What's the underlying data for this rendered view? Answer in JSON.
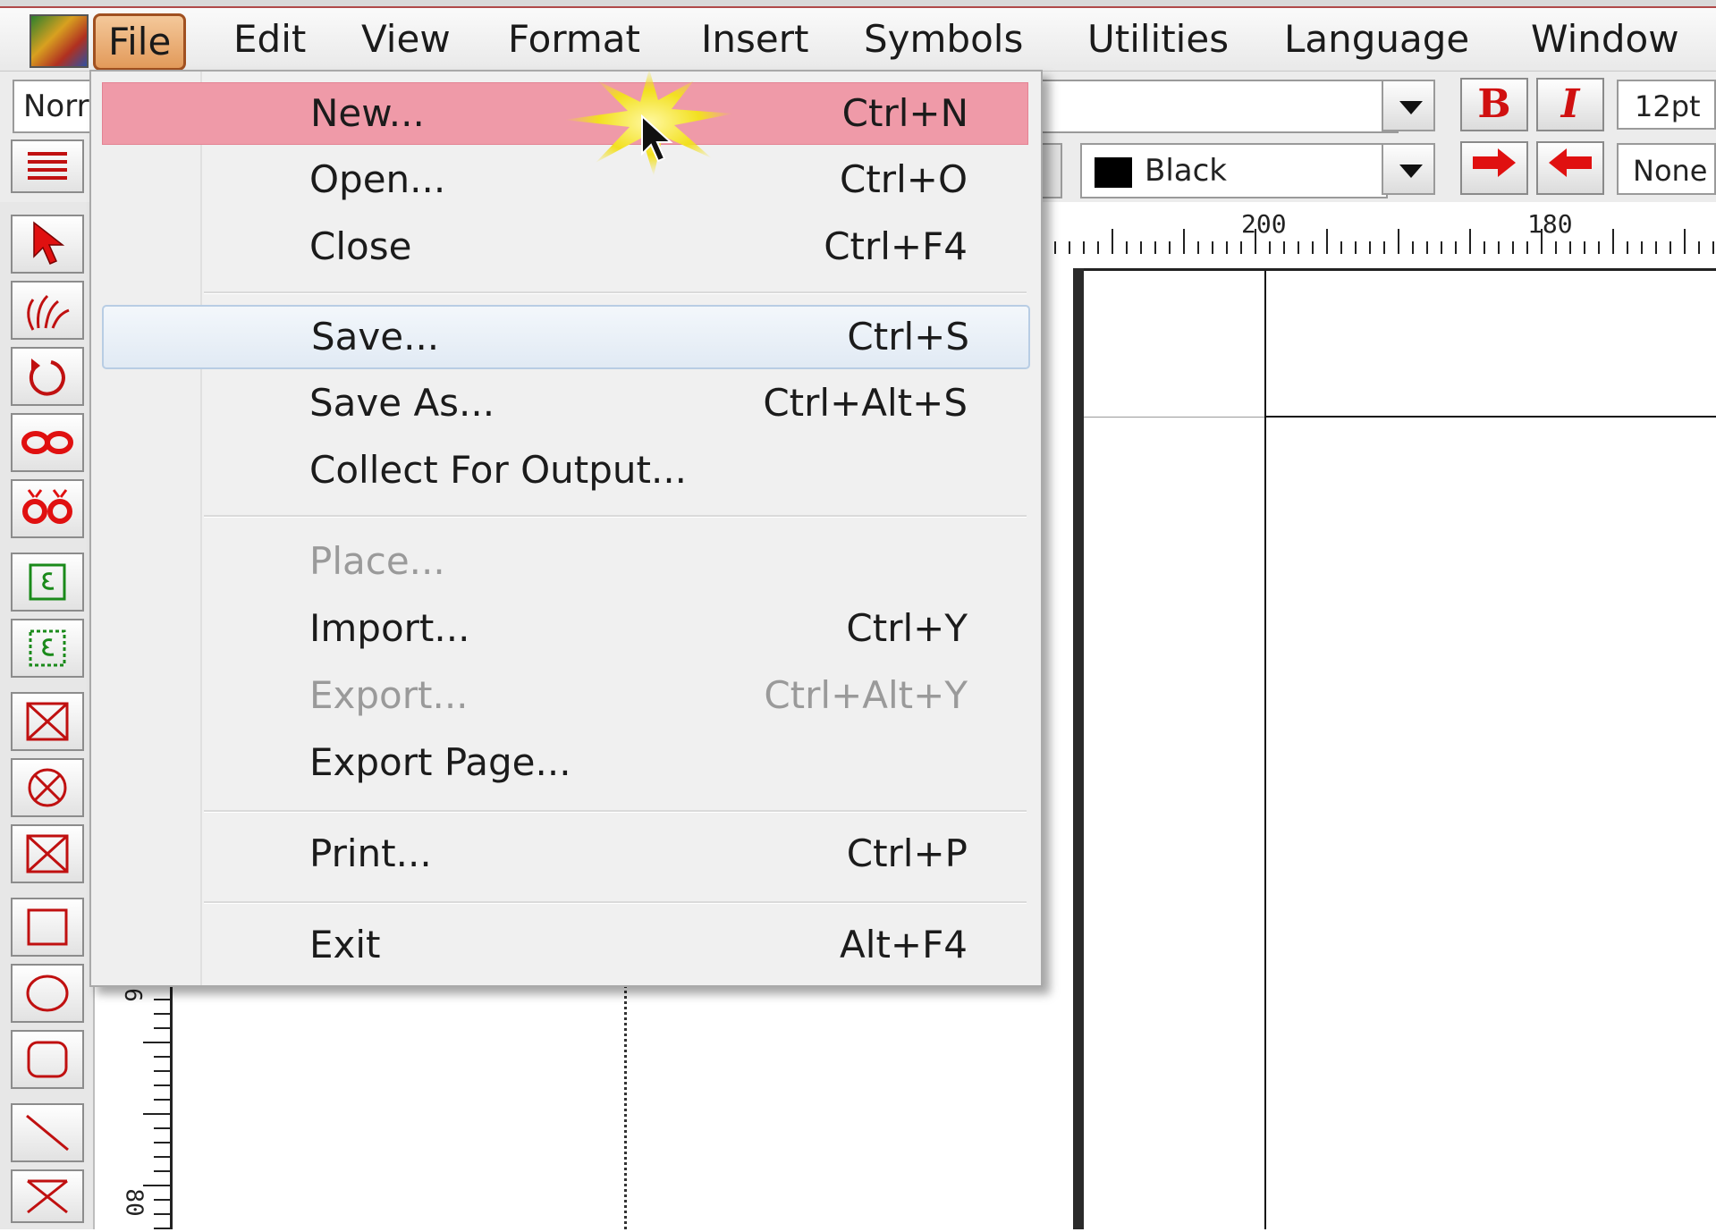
{
  "menubar": {
    "items": [
      {
        "label": "File"
      },
      {
        "label": "Edit"
      },
      {
        "label": "View"
      },
      {
        "label": "Format"
      },
      {
        "label": "Insert"
      },
      {
        "label": "Symbols"
      },
      {
        "label": "Utilities"
      },
      {
        "label": "Language"
      },
      {
        "label": "Window"
      }
    ]
  },
  "toolbar": {
    "style_value": "Norr",
    "bold_label": "B",
    "italic_label": "I",
    "font_size": "12pt",
    "color_value": "Black",
    "line_value": "None"
  },
  "ruler": {
    "h_labels": [
      "200",
      "180"
    ],
    "v_labels": [
      "6",
      "80"
    ]
  },
  "file_menu": {
    "items": [
      {
        "label": "New...",
        "shortcut": "Ctrl+N",
        "state": "hover"
      },
      {
        "label": "Open...",
        "shortcut": "Ctrl+O",
        "state": "enabled"
      },
      {
        "label": "Close",
        "shortcut": "Ctrl+F4",
        "state": "enabled"
      },
      {
        "label": "Save...",
        "shortcut": "Ctrl+S",
        "state": "focused"
      },
      {
        "label": "Save As...",
        "shortcut": "Ctrl+Alt+S",
        "state": "enabled"
      },
      {
        "label": "Collect For Output...",
        "shortcut": "",
        "state": "enabled"
      },
      {
        "label": "Place...",
        "shortcut": "",
        "state": "disabled"
      },
      {
        "label": "Import...",
        "shortcut": "Ctrl+Y",
        "state": "enabled"
      },
      {
        "label": "Export...",
        "shortcut": "Ctrl+Alt+Y",
        "state": "disabled"
      },
      {
        "label": "Export Page...",
        "shortcut": "",
        "state": "enabled"
      },
      {
        "label": "Print...",
        "shortcut": "Ctrl+P",
        "state": "enabled"
      },
      {
        "label": "Exit",
        "shortcut": "Alt+F4",
        "state": "enabled"
      }
    ]
  },
  "colors": {
    "hover_highlight": "#ef9aa8",
    "active_menu": "#e29a5a",
    "tool_red": "#d01010"
  },
  "tools": [
    "pointer-arrow-icon",
    "hand-icon",
    "rotate-icon",
    "link-frames-icon",
    "unlink-frames-icon",
    "text-frame-icon",
    "text-frame-dotted-icon",
    "picture-frame-icon",
    "oval-picture-frame-icon",
    "picture-frame-alt-icon",
    "rectangle-icon",
    "ellipse-icon",
    "rounded-rect-icon",
    "line-icon",
    "polygon-icon"
  ]
}
